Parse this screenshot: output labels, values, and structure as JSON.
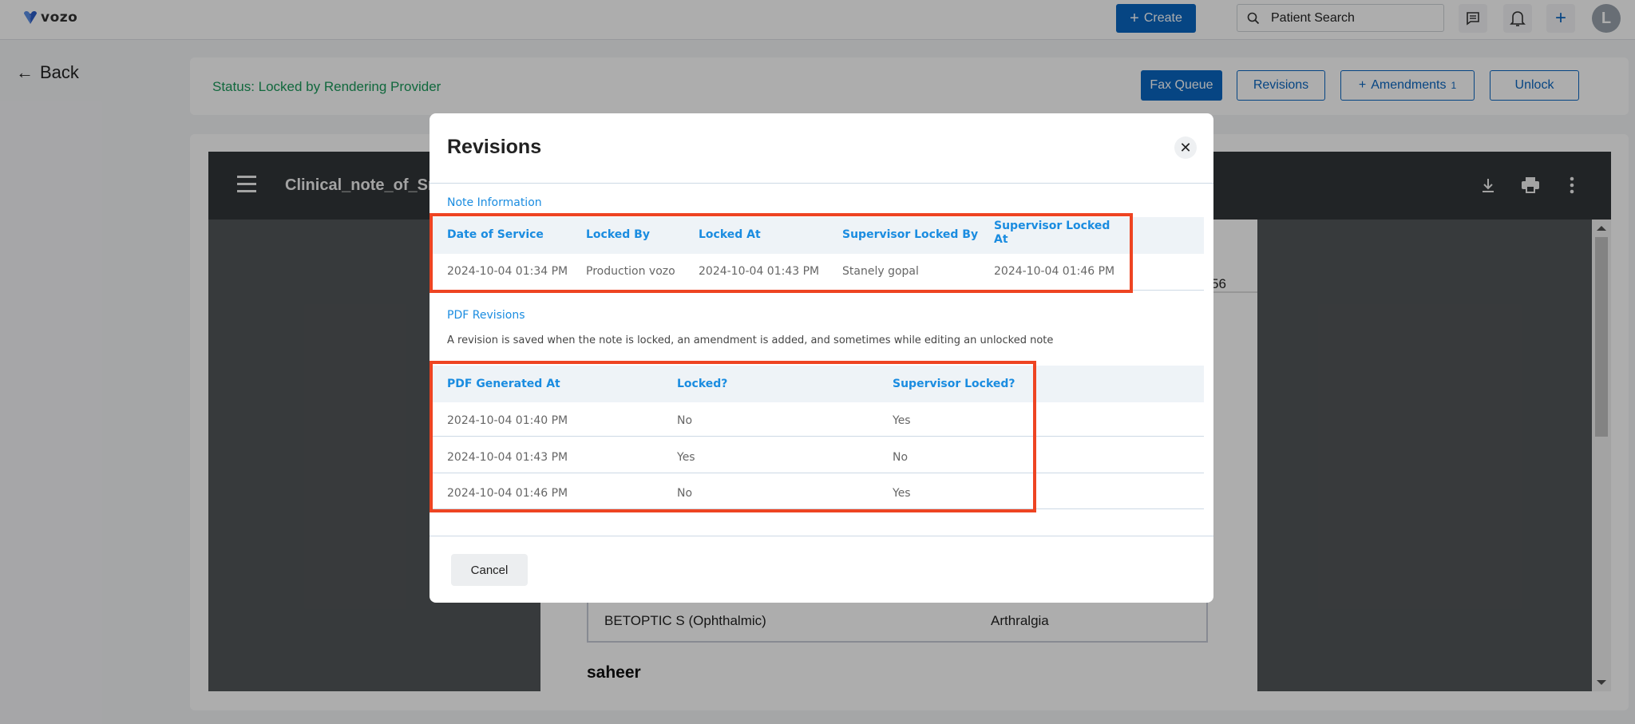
{
  "header": {
    "brand": "vozo",
    "create_label": "Create",
    "search_placeholder": "Patient Search",
    "avatar_initial": "L"
  },
  "nav": {
    "back_label": "Back"
  },
  "status_bar": {
    "status_text": "Status: Locked by Rendering Provider",
    "fax_queue_label": "Fax Queue",
    "revisions_label": "Revisions",
    "amendments_label": "Amendments",
    "amendments_count": "1",
    "unlock_label": "Unlock"
  },
  "pdf_viewer": {
    "title": "Clinical_note_of_Sm",
    "page_fragment_text": "56",
    "table_cell_medication": "BETOPTIC S (Ophthalmic)",
    "table_cell_condition": "Arthralgia",
    "section_heading": "saheer"
  },
  "modal": {
    "title": "Revisions",
    "note_info_label": "Note Information",
    "note_info_table": {
      "headers": [
        "Date of Service",
        "Locked By",
        "Locked At",
        "Supervisor Locked By",
        "Supervisor Locked At"
      ],
      "rows": [
        [
          "2024-10-04 01:34 PM",
          "Production vozo",
          "2024-10-04 01:43 PM",
          "Stanely gopal",
          "2024-10-04 01:46 PM"
        ]
      ]
    },
    "pdf_revisions_label": "PDF Revisions",
    "pdf_revisions_description": "A revision is saved when the note is locked, an amendment is added, and sometimes while editing an unlocked note",
    "pdf_revisions_table": {
      "headers": [
        "PDF Generated At",
        "Locked?",
        "Supervisor Locked?"
      ],
      "rows": [
        [
          "2024-10-04 01:40 PM",
          "No",
          "Yes"
        ],
        [
          "2024-10-04 01:43 PM",
          "Yes",
          "No"
        ],
        [
          "2024-10-04 01:46 PM",
          "No",
          "Yes"
        ]
      ]
    },
    "cancel_label": "Cancel"
  },
  "colors": {
    "primary": "#0a66c2",
    "link_blue": "#1a8ce0",
    "status_green": "#1a9a5a",
    "highlight_red": "#ee4422"
  }
}
